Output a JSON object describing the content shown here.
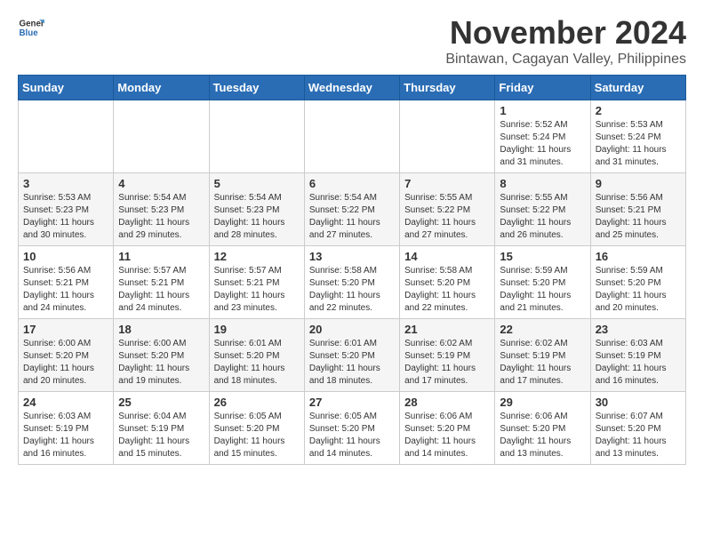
{
  "header": {
    "logo_general": "General",
    "logo_blue": "Blue",
    "month": "November 2024",
    "location": "Bintawan, Cagayan Valley, Philippines"
  },
  "days_of_week": [
    "Sunday",
    "Monday",
    "Tuesday",
    "Wednesday",
    "Thursday",
    "Friday",
    "Saturday"
  ],
  "weeks": [
    [
      {
        "day": "",
        "info": ""
      },
      {
        "day": "",
        "info": ""
      },
      {
        "day": "",
        "info": ""
      },
      {
        "day": "",
        "info": ""
      },
      {
        "day": "",
        "info": ""
      },
      {
        "day": "1",
        "info": "Sunrise: 5:52 AM\nSunset: 5:24 PM\nDaylight: 11 hours and 31 minutes."
      },
      {
        "day": "2",
        "info": "Sunrise: 5:53 AM\nSunset: 5:24 PM\nDaylight: 11 hours and 31 minutes."
      }
    ],
    [
      {
        "day": "3",
        "info": "Sunrise: 5:53 AM\nSunset: 5:23 PM\nDaylight: 11 hours and 30 minutes."
      },
      {
        "day": "4",
        "info": "Sunrise: 5:54 AM\nSunset: 5:23 PM\nDaylight: 11 hours and 29 minutes."
      },
      {
        "day": "5",
        "info": "Sunrise: 5:54 AM\nSunset: 5:23 PM\nDaylight: 11 hours and 28 minutes."
      },
      {
        "day": "6",
        "info": "Sunrise: 5:54 AM\nSunset: 5:22 PM\nDaylight: 11 hours and 27 minutes."
      },
      {
        "day": "7",
        "info": "Sunrise: 5:55 AM\nSunset: 5:22 PM\nDaylight: 11 hours and 27 minutes."
      },
      {
        "day": "8",
        "info": "Sunrise: 5:55 AM\nSunset: 5:22 PM\nDaylight: 11 hours and 26 minutes."
      },
      {
        "day": "9",
        "info": "Sunrise: 5:56 AM\nSunset: 5:21 PM\nDaylight: 11 hours and 25 minutes."
      }
    ],
    [
      {
        "day": "10",
        "info": "Sunrise: 5:56 AM\nSunset: 5:21 PM\nDaylight: 11 hours and 24 minutes."
      },
      {
        "day": "11",
        "info": "Sunrise: 5:57 AM\nSunset: 5:21 PM\nDaylight: 11 hours and 24 minutes."
      },
      {
        "day": "12",
        "info": "Sunrise: 5:57 AM\nSunset: 5:21 PM\nDaylight: 11 hours and 23 minutes."
      },
      {
        "day": "13",
        "info": "Sunrise: 5:58 AM\nSunset: 5:20 PM\nDaylight: 11 hours and 22 minutes."
      },
      {
        "day": "14",
        "info": "Sunrise: 5:58 AM\nSunset: 5:20 PM\nDaylight: 11 hours and 22 minutes."
      },
      {
        "day": "15",
        "info": "Sunrise: 5:59 AM\nSunset: 5:20 PM\nDaylight: 11 hours and 21 minutes."
      },
      {
        "day": "16",
        "info": "Sunrise: 5:59 AM\nSunset: 5:20 PM\nDaylight: 11 hours and 20 minutes."
      }
    ],
    [
      {
        "day": "17",
        "info": "Sunrise: 6:00 AM\nSunset: 5:20 PM\nDaylight: 11 hours and 20 minutes."
      },
      {
        "day": "18",
        "info": "Sunrise: 6:00 AM\nSunset: 5:20 PM\nDaylight: 11 hours and 19 minutes."
      },
      {
        "day": "19",
        "info": "Sunrise: 6:01 AM\nSunset: 5:20 PM\nDaylight: 11 hours and 18 minutes."
      },
      {
        "day": "20",
        "info": "Sunrise: 6:01 AM\nSunset: 5:20 PM\nDaylight: 11 hours and 18 minutes."
      },
      {
        "day": "21",
        "info": "Sunrise: 6:02 AM\nSunset: 5:19 PM\nDaylight: 11 hours and 17 minutes."
      },
      {
        "day": "22",
        "info": "Sunrise: 6:02 AM\nSunset: 5:19 PM\nDaylight: 11 hours and 17 minutes."
      },
      {
        "day": "23",
        "info": "Sunrise: 6:03 AM\nSunset: 5:19 PM\nDaylight: 11 hours and 16 minutes."
      }
    ],
    [
      {
        "day": "24",
        "info": "Sunrise: 6:03 AM\nSunset: 5:19 PM\nDaylight: 11 hours and 16 minutes."
      },
      {
        "day": "25",
        "info": "Sunrise: 6:04 AM\nSunset: 5:19 PM\nDaylight: 11 hours and 15 minutes."
      },
      {
        "day": "26",
        "info": "Sunrise: 6:05 AM\nSunset: 5:20 PM\nDaylight: 11 hours and 15 minutes."
      },
      {
        "day": "27",
        "info": "Sunrise: 6:05 AM\nSunset: 5:20 PM\nDaylight: 11 hours and 14 minutes."
      },
      {
        "day": "28",
        "info": "Sunrise: 6:06 AM\nSunset: 5:20 PM\nDaylight: 11 hours and 14 minutes."
      },
      {
        "day": "29",
        "info": "Sunrise: 6:06 AM\nSunset: 5:20 PM\nDaylight: 11 hours and 13 minutes."
      },
      {
        "day": "30",
        "info": "Sunrise: 6:07 AM\nSunset: 5:20 PM\nDaylight: 11 hours and 13 minutes."
      }
    ]
  ]
}
